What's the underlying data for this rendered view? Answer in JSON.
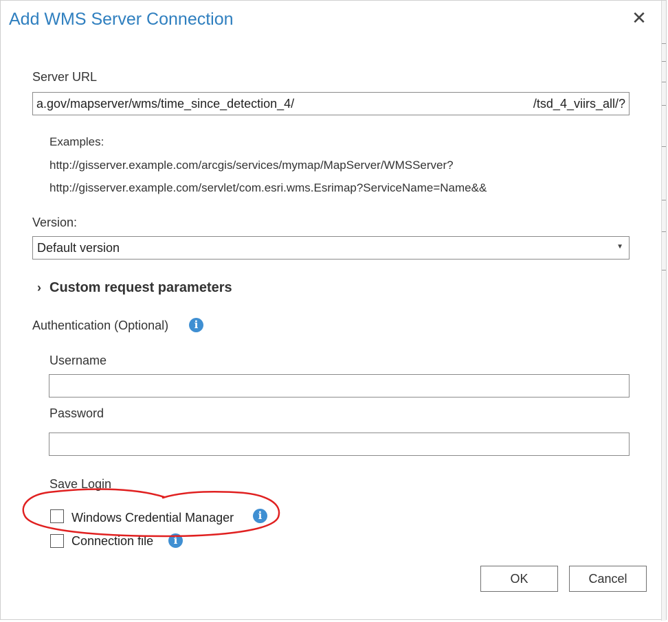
{
  "dialog": {
    "title": "Add WMS Server Connection",
    "close_icon": "close-icon ✕"
  },
  "server_url": {
    "label": "Server URL",
    "value_left": "a.gov/mapserver/wms/time_since_detection_4/",
    "value_right": "/tsd_4_viirs_all/?"
  },
  "examples": {
    "heading": "Examples:",
    "items": [
      "http://gisserver.example.com/arcgis/services/mymap/MapServer/WMSServer?",
      "http://gisserver.example.com/servlet/com.esri.wms.Esrimap?ServiceName=Name&&"
    ]
  },
  "version": {
    "label": "Version:",
    "selected": "Default version"
  },
  "custom_params": {
    "label": "Custom request parameters",
    "expanded": false
  },
  "authentication": {
    "label": "Authentication (Optional)",
    "username_label": "Username",
    "username_value": "",
    "password_label": "Password",
    "password_value": ""
  },
  "save_login": {
    "label": "Save Login",
    "options": [
      {
        "label": "Windows Credential Manager",
        "checked": false
      },
      {
        "label": "Connection file",
        "checked": false
      }
    ]
  },
  "buttons": {
    "ok": "OK",
    "cancel": "Cancel"
  },
  "colors": {
    "title": "#2f7fbf",
    "info_icon": "#3f8fd2",
    "annotation": "#e02020"
  }
}
